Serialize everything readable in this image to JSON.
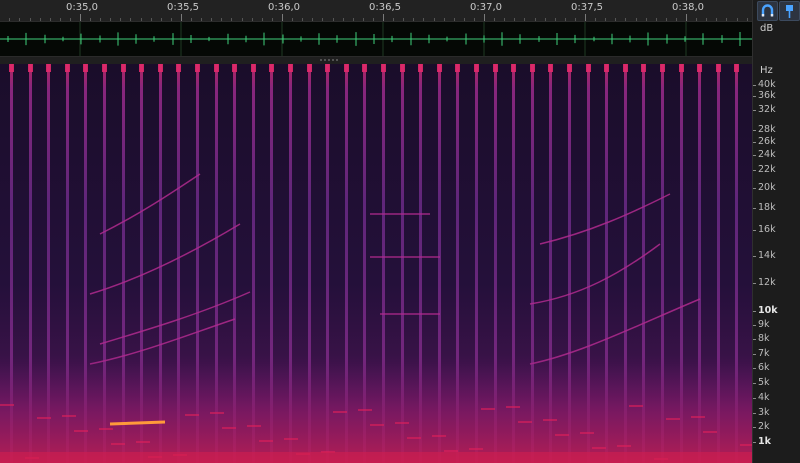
{
  "ruler": {
    "labels": [
      "0:35,0",
      "0:35,5",
      "0:36,0",
      "0:36,5",
      "0:37,0",
      "0:37,5",
      "0:38,0"
    ]
  },
  "panel": {
    "db_label": "dB",
    "hz_label": "Hz",
    "freq_labels": [
      "40k",
      "36k",
      "32k",
      "28k",
      "26k",
      "24k",
      "22k",
      "20k",
      "18k",
      "16k",
      "14k",
      "12k",
      "10k",
      "9k",
      "8k",
      "7k",
      "6k",
      "5k",
      "4k",
      "3k",
      "2k",
      "1k"
    ],
    "icons": [
      "horseshoe-magnet-icon",
      "marker-pin-icon"
    ]
  },
  "colors": {
    "waveform": "#3fd07a",
    "spectral_low": "#1a0a2a",
    "spectral_mid": "#6a1a72",
    "spectral_high": "#e0205a",
    "accent_blue": "#4aa3ff"
  }
}
